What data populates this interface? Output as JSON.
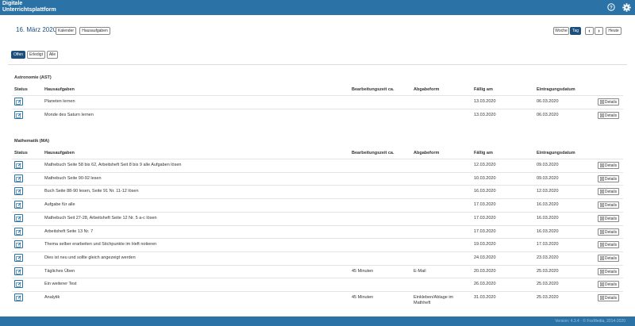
{
  "app": {
    "title_line1": "Digitale",
    "title_line2": "Unterrichtsplattform"
  },
  "header": {
    "date": "16. März 2020",
    "calendar_label": "Kalender",
    "homework_label": "Hausaufgaben",
    "week_label": "Woche",
    "day_label": "Tag",
    "prev_label": "‹",
    "next_label": "›",
    "today_label": "Heute"
  },
  "filters": {
    "open": "Offen",
    "done": "Erledigt",
    "all": "Alle"
  },
  "columns": {
    "status": "Status",
    "homework": "Hausaufgaben",
    "time": "Bearbeitungszeit ca.",
    "form": "Abgabeform",
    "due": "Fällig am",
    "entered": "Eintragungsdatum"
  },
  "details_label": "Details",
  "sections": [
    {
      "title": "Astronomie (AST)",
      "rows": [
        {
          "task": "Planeten lernen",
          "time": "",
          "form": "",
          "due": "13.03.2020",
          "entered": "06.03.2020"
        },
        {
          "task": "Monde des Saturn lernen",
          "time": "",
          "form": "",
          "due": "13.03.2020",
          "entered": "06.03.2020"
        }
      ]
    },
    {
      "title": "Mathematik (MA)",
      "rows": [
        {
          "task": "Mathebuch Seite 58 bis 62, Arbeitsheft Seit 8 bis 9 alle Aufgaben lösen",
          "time": "",
          "form": "",
          "due": "12.03.2020",
          "entered": "09.03.2020"
        },
        {
          "task": "Mathebuch Seite 90-92 lesen",
          "time": "",
          "form": "",
          "due": "10.03.2020",
          "entered": "09.03.2020"
        },
        {
          "task": "Buch Seite 88-90 lesen, Seite 91 Nr. 11-12 lösen",
          "time": "",
          "form": "",
          "due": "16.03.2020",
          "entered": "12.03.2020"
        },
        {
          "task": "Aufgabe für alle",
          "time": "",
          "form": "",
          "due": "17.03.2020",
          "entered": "16.03.2020"
        },
        {
          "task": "Mathebuch Seit 27-28, Arbeitsheft Seite 12 Nr. 5 a-c lösen",
          "time": "",
          "form": "",
          "due": "17.03.2020",
          "entered": "16.03.2020"
        },
        {
          "task": "Arbeitsheft Seite 13 Nr. 7",
          "time": "",
          "form": "",
          "due": "17.03.2020",
          "entered": "16.03.2020"
        },
        {
          "task": "Thema selber erarbeiten und Stichpunkte im Heft notieren",
          "time": "",
          "form": "",
          "due": "19.03.2020",
          "entered": "17.03.2020"
        },
        {
          "task": "Dies ist neu und sollte gleich angezeigt werden",
          "time": "",
          "form": "",
          "due": "24.03.2020",
          "entered": "23.03.2020"
        },
        {
          "task": "Tägliches Üben",
          "time": "45 Minuten",
          "form": "E-Mail",
          "due": "20.03.2020",
          "entered": "25.03.2020"
        },
        {
          "task": "Ein weiterer Test",
          "time": "",
          "form": "",
          "due": "26.03.2020",
          "entered": "25.03.2020"
        },
        {
          "task": "Analytik",
          "time": "45 Minuten",
          "form": "Einkleben/Ablage im Mathheft",
          "due": "31.03.2020",
          "entered": "25.03.2020"
        }
      ]
    }
  ],
  "footer": {
    "version": "Version: 4.3.4 · © FoxMedia, 2014-2020"
  },
  "colors": {
    "primary": "#2b73a6",
    "dark": "#1c4f7a"
  },
  "icons": {
    "help": "help-icon",
    "settings": "gear-icon",
    "status": "edit-icon",
    "details": "list-icon"
  }
}
